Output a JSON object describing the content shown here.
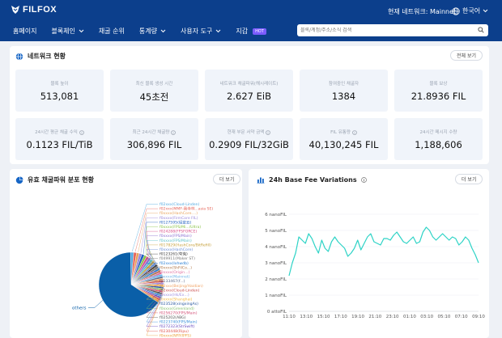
{
  "header": {
    "logo": "FILFOX",
    "network": "현재 네트워크: Mainnet",
    "language": "한국어",
    "nav": [
      {
        "label": "홈페이지",
        "dropdown": false
      },
      {
        "label": "블록체인",
        "dropdown": true
      },
      {
        "label": "채굴 순위",
        "dropdown": false
      },
      {
        "label": "통계량",
        "dropdown": true
      },
      {
        "label": "사용자 도구",
        "dropdown": true
      },
      {
        "label": "지갑",
        "dropdown": false,
        "badge": "HOT"
      }
    ],
    "search_placeholder": "블록/계정/주소/소식 검색"
  },
  "network_panel": {
    "title": "네트워크 현황",
    "more": "전체 보기",
    "stats": [
      {
        "label": "블록 높이",
        "value": "513,081",
        "info": false
      },
      {
        "label": "최신 블록 생성 시간",
        "value": "45초전",
        "info": false
      },
      {
        "label": "네트워크 채굴파워(해시레이트)",
        "value": "2.627 EiB",
        "info": false
      },
      {
        "label": "참여중인 채굴자",
        "value": "1384",
        "info": false
      },
      {
        "label": "블록 보상",
        "value": "21.8936 FIL",
        "info": false
      },
      {
        "label": "24시간 평균 채굴 수익",
        "value": "0.1123 FIL/TiB",
        "info": true
      },
      {
        "label": "최근 24시간 채굴량",
        "value": "306,896 FIL",
        "info": true
      },
      {
        "label": "현재 부문 서약 금액",
        "value": "0.2909 FIL/32GiB",
        "info": true
      },
      {
        "label": "FIL 유통량",
        "value": "40,130,245 FIL",
        "info": true
      },
      {
        "label": "24시간 메시지 수량",
        "value": "1,188,606",
        "info": false
      }
    ]
  },
  "pie_panel": {
    "title": "유효 채굴파워 분포 현황",
    "more": "더 보기",
    "labels": [
      {
        "text": "f02xxx(Cloud-Linden)",
        "color": "#4fa8e0"
      },
      {
        "text": "f02xxx(MMF-我寺林...asia SE)",
        "color": "#e5655a"
      },
      {
        "text": "f0xxxx(HashCore....)",
        "color": "#e8a35c"
      },
      {
        "text": "f0xxxx(FirmCore FIL)",
        "color": "#9b87d9"
      },
      {
        "text": "f0127595(经定云)",
        "color": "#1f5fbf"
      },
      {
        "text": "f0xxxx(FPS/Mi.../Ultra)",
        "color": "#8bc34a"
      },
      {
        "text": "f024288(FFSFORCE)",
        "color": "#d94f8a"
      },
      {
        "text": "f0xxxx(FPS/Main)",
        "color": "#8a6fd1"
      },
      {
        "text": "f0xxxx(FPS/Main)",
        "color": "#5cc0c7"
      },
      {
        "text": "f017829(HashCore/BitRefill)",
        "color": "#c6a13e"
      },
      {
        "text": "f0xxxx(HashCore)",
        "color": "#6b8fd6"
      },
      {
        "text": "f0123261(夸克)",
        "color": "#3a3a3a"
      },
      {
        "text": "f049911(Maker ST)",
        "color": "#7a7a7a"
      },
      {
        "text": "f02xxx(Ixhwdb)",
        "color": "#2a7fd4"
      },
      {
        "text": "f0xxxx(ShFilCo...)",
        "color": "#b07a4e"
      },
      {
        "text": "f0xxxx(Origin...)",
        "color": "#e06fa0"
      },
      {
        "text": "f0xxxx(Mainnet)",
        "color": "#6db3e8"
      },
      {
        "text": "f0133467(f...)",
        "color": "#5b6b8c"
      },
      {
        "text": "f02xxx(Beijing/Haidian)",
        "color": "#f0a060"
      },
      {
        "text": "f02xxx(Cloud-Linden)",
        "color": "#c94a4a"
      },
      {
        "text": "f0xxxx(Hk/Ex...)",
        "color": "#9f8fe0"
      },
      {
        "text": "f0xxxx(Shanghai)",
        "color": "#f4b942"
      },
      {
        "text": "f023528(xingxingAs)",
        "color": "#2c5aa0"
      },
      {
        "text": "f0xxxx(Greenland)",
        "color": "#88c070"
      },
      {
        "text": "f0256270(FPS/Main)",
        "color": "#d4547a"
      },
      {
        "text": "f025202(ABG)",
        "color": "#555555"
      },
      {
        "text": "f0223740(FPS/Main)",
        "color": "#3a8fd9"
      },
      {
        "text": "f0272323(StrSwift)",
        "color": "#6c4fc1"
      },
      {
        "text": "f0230448(Ripu)",
        "color": "#e0574e"
      },
      {
        "text": "f0xxxx(NFP/IPFS)",
        "color": "#e9a13b"
      },
      {
        "text": "others",
        "color": "#0a5fa8"
      }
    ],
    "chart_data": {
      "type": "pie",
      "title": "유효 채굴파워 분포 현황",
      "slices": [
        {
          "name": "others",
          "value": 63
        },
        {
          "name": "f02xxx(Cloud-Linden)",
          "value": 1.5
        },
        {
          "name": "f02xxx(MMF-我寺林...asia SE)",
          "value": 1.4
        },
        {
          "name": "f0xxxx(HashCore....)",
          "value": 1.3
        },
        {
          "name": "f0xxxx(FirmCore FIL)",
          "value": 1.3
        },
        {
          "name": "f0127595(经定云)",
          "value": 1.3
        },
        {
          "name": "f0xxxx(FPS/Mi.../Ultra)",
          "value": 1.2
        },
        {
          "name": "f024288(FFSFORCE)",
          "value": 1.2
        },
        {
          "name": "f0xxxx(FPS/Main)",
          "value": 1.2
        },
        {
          "name": "f0xxxx(FPS/Main)",
          "value": 1.2
        },
        {
          "name": "f017829(HashCore/BitRefill)",
          "value": 1.2
        },
        {
          "name": "f0xxxx(HashCore)",
          "value": 1.1
        },
        {
          "name": "f0123261(夸克)",
          "value": 1.1
        },
        {
          "name": "f049911(Maker ST)",
          "value": 1.1
        },
        {
          "name": "f02xxx(Ixhwdb)",
          "value": 1.1
        },
        {
          "name": "f0xxxx(ShFilCo...)",
          "value": 1.1
        },
        {
          "name": "f0xxxx(Origin...)",
          "value": 1.0
        },
        {
          "name": "f0xxxx(Mainnet)",
          "value": 1.0
        },
        {
          "name": "f0133467(f...)",
          "value": 1.0
        },
        {
          "name": "f02xxx(Beijing/Haidian)",
          "value": 1.0
        },
        {
          "name": "f02xxx(Cloud-Linden)",
          "value": 1.0
        },
        {
          "name": "f0xxxx(Hk/Ex...)",
          "value": 1.0
        },
        {
          "name": "f0xxxx(Shanghai)",
          "value": 1.0
        },
        {
          "name": "f023528(xingxingAs)",
          "value": 1.0
        },
        {
          "name": "f0xxxx(Greenland)",
          "value": 1.0
        },
        {
          "name": "f0256270(FPS/Main)",
          "value": 1.0
        },
        {
          "name": "f025202(ABG)",
          "value": 1.0
        },
        {
          "name": "f0223740(FPS/Main)",
          "value": 1.0
        },
        {
          "name": "f0272323(StrSwift)",
          "value": 1.0
        },
        {
          "name": "f0230448(Ripu)",
          "value": 1.0
        },
        {
          "name": "f0xxxx(NFP/IPFS)",
          "value": 1.0
        }
      ]
    }
  },
  "fee_panel": {
    "title": "24h Base Fee Variations",
    "more": "더 보기",
    "chart_data": {
      "type": "line",
      "title": "24h Base Fee Variations",
      "x_ticks": [
        "11:10",
        "13:10",
        "15:10",
        "17:10",
        "19:10",
        "21:10",
        "23:10",
        "01:10",
        "03:10",
        "05:10",
        "07:10",
        "09:10"
      ],
      "y_ticks": [
        "0 attoFIL",
        "1 nanoFIL",
        "2 nanoFIL",
        "3 nanoFIL",
        "4 nanoFIL",
        "5 nanoFIL",
        "6 nanoFIL"
      ],
      "ylim": [
        0,
        6
      ],
      "x": [
        0,
        0.4,
        0.8,
        1.2,
        1.6,
        2,
        2.4,
        2.8,
        3.2,
        3.6,
        4,
        4.4,
        4.8,
        5.2,
        5.6,
        6,
        6.4,
        6.8,
        7.2,
        7.6,
        8,
        8.4,
        8.8,
        9.2,
        9.6,
        10,
        10.4,
        10.8,
        11.2,
        11.6,
        12,
        12.4,
        12.8,
        13.2,
        13.6,
        14,
        14.4,
        14.8,
        15.2,
        15.6,
        16,
        16.4,
        16.8,
        17.2,
        17.6,
        18,
        18.4,
        18.8,
        19.2,
        19.6,
        20,
        20.4,
        20.8,
        21.2,
        21.6,
        22,
        22.4,
        22.8,
        23.2
      ],
      "series": [
        {
          "values": [
            2.2,
            3.0,
            3.6,
            4.6,
            4.4,
            4.2,
            4.8,
            4.5,
            4.0,
            3.6,
            4.4,
            3.9,
            3.7,
            4.3,
            4.6,
            4.3,
            4.1,
            3.9,
            3.4,
            3.6,
            3.9,
            4.4,
            3.8,
            4.2,
            4.6,
            4.8,
            4.3,
            4.2,
            4.1,
            4.5,
            4.5,
            4.4,
            4.7,
            4.9,
            4.6,
            4.3,
            4.2,
            4.4,
            4.6,
            4.2,
            4.3,
            4.9,
            5.2,
            5.0,
            4.6,
            4.4,
            4.6,
            4.8,
            4.6,
            4.4,
            4.6,
            4.5,
            4.1,
            4.3,
            4.6,
            4.4,
            3.9,
            3.5,
            3.0
          ],
          "color": "#2ed3c6"
        }
      ]
    }
  }
}
